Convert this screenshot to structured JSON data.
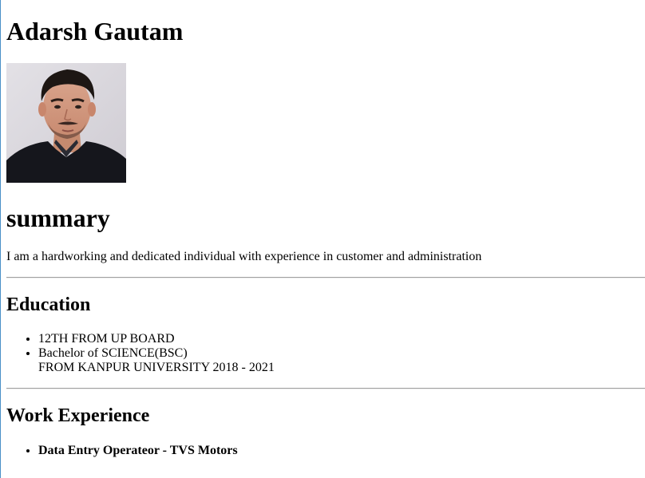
{
  "header": {
    "name": "Adarsh Gautam"
  },
  "photo": {
    "alt": "profile photo"
  },
  "summary": {
    "heading": "summary",
    "text": "I am a hardworking and dedicated individual with experience in customer and administration"
  },
  "education": {
    "heading": "Education",
    "items": [
      {
        "line1": "12TH FROM UP BOARD",
        "line2": ""
      },
      {
        "line1": "Bachelor of SCIENCE(BSC)",
        "line2": "FROM KANPUR UNIVERSITY 2018 - 2021"
      }
    ]
  },
  "work": {
    "heading": "Work Experience",
    "items": [
      {
        "title": "Data Entry Operateor - TVS Motors"
      }
    ]
  },
  "colors": {
    "background": "#ffffff",
    "text": "#000000",
    "divider": "#a0a0a0",
    "left_edge": "#4a90c8"
  }
}
